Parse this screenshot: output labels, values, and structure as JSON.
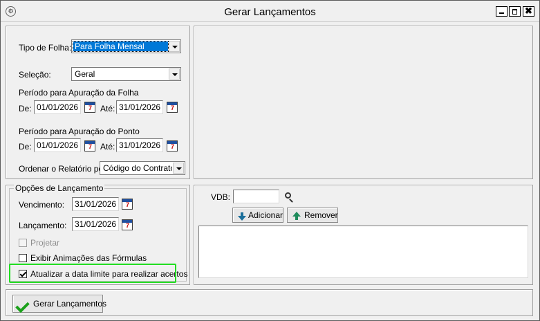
{
  "window": {
    "title": "Gerar Lançamentos",
    "controls": {
      "minimize": "",
      "maximize": "",
      "close": "✖"
    },
    "icon": "gear-icon"
  },
  "top_panel": {
    "tipo_folha_label": "Tipo de Folha:",
    "tipo_folha_value": "Para Folha Mensal",
    "selecao_label": "Seleção:",
    "selecao_value": "Geral",
    "periodo_folha_label": "Período para Apuração da Folha",
    "periodo_folha_de_label": "De:",
    "periodo_folha_de": "01/01/2026",
    "periodo_folha_ate_label": "Até:",
    "periodo_folha_ate": "31/01/2026",
    "periodo_ponto_label": "Período para Apuração do Ponto",
    "periodo_ponto_de_label": "De:",
    "periodo_ponto_de": "01/01/2026",
    "periodo_ponto_ate_label": "Até:",
    "periodo_ponto_ate": "31/01/2026",
    "ordenar_label": "Ordenar o Relatório por:",
    "ordenar_value": "Código do Contrato"
  },
  "opcoes": {
    "title": "Opções de Lançamento",
    "vencimento_label": "Vencimento:",
    "vencimento_value": "31/01/2026",
    "lancamento_label": "Lançamento:",
    "lancamento_value": "31/01/2026",
    "projetar_label": "Projetar",
    "projetar_checked": false,
    "projetar_enabled": false,
    "exibir_label": "Exibir Animações das Fórmulas",
    "exibir_checked": false,
    "atualizar_label": "Atualizar a data limite para realizar acertos",
    "atualizar_checked": true
  },
  "vdb": {
    "label": "VDB:",
    "value": "",
    "adicionar_label": "Adicionar",
    "remover_label": "Remover"
  },
  "footer": {
    "gerar_label": "Gerar Lançamentos"
  },
  "colors": {
    "highlight": "#22dd22",
    "selection": "#0078d7"
  }
}
